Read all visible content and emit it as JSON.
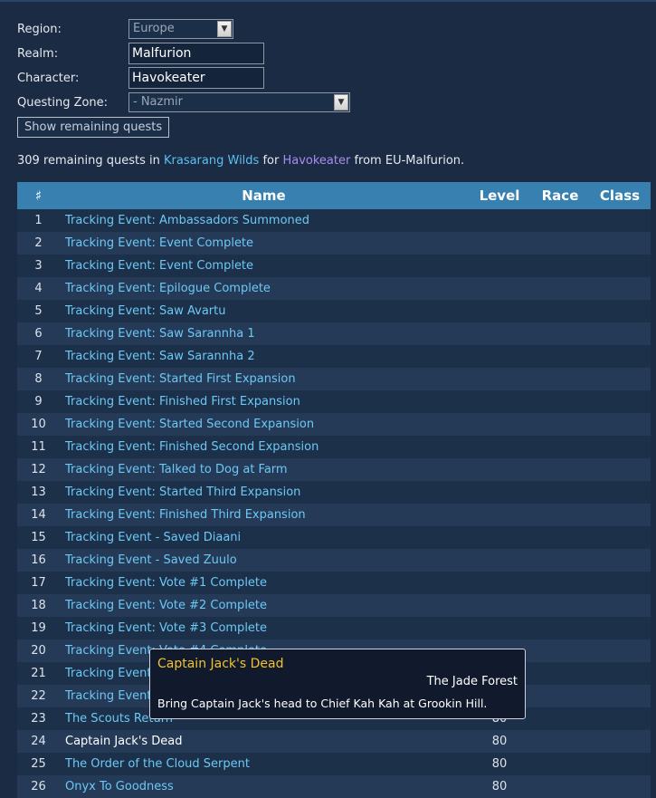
{
  "form": {
    "region_label": "Region:",
    "region_value": "Europe",
    "realm_label": "Realm:",
    "realm_value": "Malfurion",
    "character_label": "Character:",
    "character_value": "Havokeater",
    "zone_label": "Questing Zone:",
    "zone_value": "- Nazmir",
    "submit_label": "Show remaining quests"
  },
  "summary": {
    "prefix": "309 remaining quests in",
    "zone": "Krasarang Wilds",
    "for": "for",
    "character": "Havokeater",
    "suffix": "from EU-Malfurion."
  },
  "table": {
    "headers": {
      "num": "♯",
      "name": "Name",
      "level": "Level",
      "race": "Race",
      "class": "Class"
    },
    "rows": [
      {
        "num": "1",
        "name": "Tracking Event: Ambassadors Summoned",
        "level": "",
        "link": true
      },
      {
        "num": "2",
        "name": "Tracking Event: Event Complete",
        "level": "",
        "link": true
      },
      {
        "num": "3",
        "name": "Tracking Event: Event Complete",
        "level": "",
        "link": true
      },
      {
        "num": "4",
        "name": "Tracking Event: Epilogue Complete",
        "level": "",
        "link": true
      },
      {
        "num": "5",
        "name": "Tracking Event: Saw Avartu",
        "level": "",
        "link": true
      },
      {
        "num": "6",
        "name": "Tracking Event: Saw Sarannha 1",
        "level": "",
        "link": true
      },
      {
        "num": "7",
        "name": "Tracking Event: Saw Sarannha 2",
        "level": "",
        "link": true
      },
      {
        "num": "8",
        "name": "Tracking Event: Started First Expansion",
        "level": "",
        "link": true
      },
      {
        "num": "9",
        "name": "Tracking Event: Finished First Expansion",
        "level": "",
        "link": true
      },
      {
        "num": "10",
        "name": "Tracking Event: Started Second Expansion",
        "level": "",
        "link": true
      },
      {
        "num": "11",
        "name": "Tracking Event: Finished Second Expansion",
        "level": "",
        "link": true
      },
      {
        "num": "12",
        "name": "Tracking Event: Talked to Dog at Farm",
        "level": "",
        "link": true
      },
      {
        "num": "13",
        "name": "Tracking Event: Started Third Expansion",
        "level": "",
        "link": true
      },
      {
        "num": "14",
        "name": "Tracking Event: Finished Third Expansion",
        "level": "",
        "link": true
      },
      {
        "num": "15",
        "name": "Tracking Event - Saved Diaani",
        "level": "",
        "link": true
      },
      {
        "num": "16",
        "name": "Tracking Event - Saved Zuulo",
        "level": "",
        "link": true
      },
      {
        "num": "17",
        "name": "Tracking Event: Vote #1 Complete",
        "level": "",
        "link": true
      },
      {
        "num": "18",
        "name": "Tracking Event: Vote #2 Complete",
        "level": "",
        "link": true
      },
      {
        "num": "19",
        "name": "Tracking Event: Vote #3 Complete",
        "level": "",
        "link": true
      },
      {
        "num": "20",
        "name": "Tracking Event: Vote #4 Complete",
        "level": "",
        "link": true
      },
      {
        "num": "21",
        "name": "Tracking Event: Vote #5 Complete",
        "level": "",
        "link": true
      },
      {
        "num": "22",
        "name": "Tracking Event: Vote #6 Complete",
        "level": "",
        "link": true
      },
      {
        "num": "23",
        "name": "The Scouts Return",
        "level": "80",
        "link": true
      },
      {
        "num": "24",
        "name": "Captain Jack's Dead",
        "level": "80",
        "link": false
      },
      {
        "num": "25",
        "name": "The Order of the Cloud Serpent",
        "level": "80",
        "link": true
      },
      {
        "num": "26",
        "name": "Onyx To Goodness",
        "level": "80",
        "link": true
      }
    ]
  },
  "tooltip": {
    "title": "Captain Jack's Dead",
    "zone": "The Jade Forest",
    "description": "Bring Captain Jack's head to Chief Kah Kah at Grookin Hill."
  },
  "colors": {
    "background": "#1a2b43",
    "header": "#3780b0",
    "link": "#6cc8f5",
    "character_link": "#a98cf2",
    "tooltip_title": "#f2c230"
  }
}
